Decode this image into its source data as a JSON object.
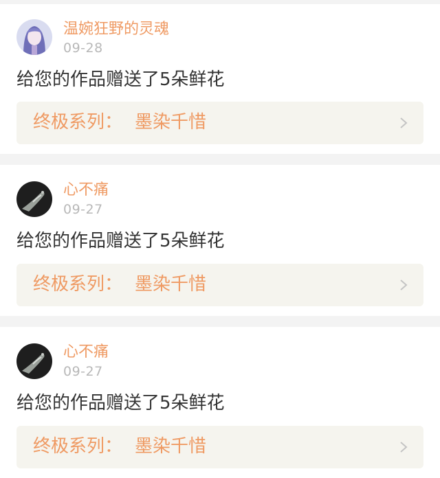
{
  "notifications": [
    {
      "username": "温婉狂野的灵魂",
      "date": "09-28",
      "message": "给您的作品赠送了5朵鲜花",
      "work_prefix": "终极系列：",
      "work_title": "墨染千惜",
      "avatar_icon": "anime-girl-avatar"
    },
    {
      "username": "心不痛",
      "date": "09-27",
      "message": "给您的作品赠送了5朵鲜花",
      "work_prefix": "终极系列：",
      "work_title": "墨染千惜",
      "avatar_icon": "dark-hand-avatar"
    },
    {
      "username": "心不痛",
      "date": "09-27",
      "message": "给您的作品赠送了5朵鲜花",
      "work_prefix": "终极系列：",
      "work_title": "墨染千惜",
      "avatar_icon": "dark-hand-avatar"
    }
  ],
  "colors": {
    "username": "#ef9a63",
    "date": "#b8b8b8",
    "message": "#333333",
    "link_bg": "#f5f4ee",
    "page_bg": "#f3f3f3"
  }
}
